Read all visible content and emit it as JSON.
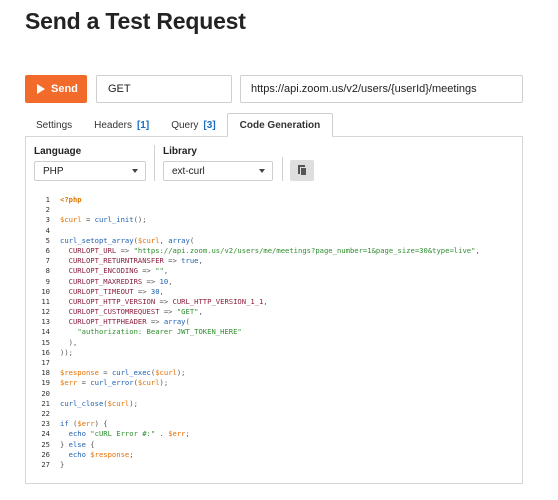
{
  "page": {
    "title": "Send a Test Request"
  },
  "request": {
    "send_label": "Send",
    "method": "GET",
    "url": "https://api.zoom.us/v2/users/{userId}/meetings"
  },
  "tabs": [
    {
      "label": "Settings",
      "count": ""
    },
    {
      "label": "Headers",
      "count": "[1]"
    },
    {
      "label": "Query",
      "count": "[3]"
    },
    {
      "label": "Code Generation",
      "count": "",
      "active": true
    }
  ],
  "codegen": {
    "language_label": "Language",
    "language_value": "PHP",
    "library_label": "Library",
    "library_value": "ext-curl",
    "copy_icon": "copy-icon"
  },
  "code_lines": [
    {
      "n": "1",
      "tokens": [
        [
          "kw",
          "<?php"
        ]
      ]
    },
    {
      "n": "2",
      "tokens": []
    },
    {
      "n": "3",
      "tokens": [
        [
          "var",
          "$curl"
        ],
        [
          "op",
          " = "
        ],
        [
          "fn",
          "curl_init"
        ],
        [
          "op",
          "();"
        ]
      ]
    },
    {
      "n": "4",
      "tokens": []
    },
    {
      "n": "5",
      "tokens": [
        [
          "fn",
          "curl_setopt_array"
        ],
        [
          "op",
          "("
        ],
        [
          "var",
          "$curl"
        ],
        [
          "op",
          ", "
        ],
        [
          "kw2",
          "array"
        ],
        [
          "op",
          "("
        ]
      ]
    },
    {
      "n": "6",
      "tokens": [
        [
          "op",
          "  "
        ],
        [
          "const",
          "CURLOPT_URL"
        ],
        [
          "op",
          " => "
        ],
        [
          "str",
          "\"https://api.zoom.us/v2/users/me/meetings?page_number=1&page_size=30&type=live\""
        ],
        [
          "op",
          ","
        ]
      ]
    },
    {
      "n": "7",
      "tokens": [
        [
          "op",
          "  "
        ],
        [
          "const",
          "CURLOPT_RETURNTRANSFER"
        ],
        [
          "op",
          " => "
        ],
        [
          "kw2",
          "true"
        ],
        [
          "op",
          ","
        ]
      ]
    },
    {
      "n": "8",
      "tokens": [
        [
          "op",
          "  "
        ],
        [
          "const",
          "CURLOPT_ENCODING"
        ],
        [
          "op",
          " => "
        ],
        [
          "str",
          "\"\""
        ],
        [
          "op",
          ","
        ]
      ]
    },
    {
      "n": "9",
      "tokens": [
        [
          "op",
          "  "
        ],
        [
          "const",
          "CURLOPT_MAXREDIRS"
        ],
        [
          "op",
          " => "
        ],
        [
          "num",
          "10"
        ],
        [
          "op",
          ","
        ]
      ]
    },
    {
      "n": "10",
      "tokens": [
        [
          "op",
          "  "
        ],
        [
          "const",
          "CURLOPT_TIMEOUT"
        ],
        [
          "op",
          " => "
        ],
        [
          "num",
          "30"
        ],
        [
          "op",
          ","
        ]
      ]
    },
    {
      "n": "11",
      "tokens": [
        [
          "op",
          "  "
        ],
        [
          "const",
          "CURLOPT_HTTP_VERSION"
        ],
        [
          "op",
          " => "
        ],
        [
          "const",
          "CURL_HTTP_VERSION_1_1"
        ],
        [
          "op",
          ","
        ]
      ]
    },
    {
      "n": "12",
      "tokens": [
        [
          "op",
          "  "
        ],
        [
          "const",
          "CURLOPT_CUSTOMREQUEST"
        ],
        [
          "op",
          " => "
        ],
        [
          "str",
          "\"GET\""
        ],
        [
          "op",
          ","
        ]
      ]
    },
    {
      "n": "13",
      "tokens": [
        [
          "op",
          "  "
        ],
        [
          "const",
          "CURLOPT_HTTPHEADER"
        ],
        [
          "op",
          " => "
        ],
        [
          "kw2",
          "array"
        ],
        [
          "op",
          "("
        ]
      ]
    },
    {
      "n": "14",
      "tokens": [
        [
          "op",
          "    "
        ],
        [
          "str",
          "\"authorization: Bearer JWT_TOKEN_HERE\""
        ]
      ]
    },
    {
      "n": "15",
      "tokens": [
        [
          "op",
          "  ),"
        ]
      ]
    },
    {
      "n": "16",
      "tokens": [
        [
          "op",
          "));"
        ]
      ]
    },
    {
      "n": "17",
      "tokens": []
    },
    {
      "n": "18",
      "tokens": [
        [
          "var",
          "$response"
        ],
        [
          "op",
          " = "
        ],
        [
          "fn",
          "curl_exec"
        ],
        [
          "op",
          "("
        ],
        [
          "var",
          "$curl"
        ],
        [
          "op",
          ");"
        ]
      ]
    },
    {
      "n": "19",
      "tokens": [
        [
          "var",
          "$err"
        ],
        [
          "op",
          " = "
        ],
        [
          "fn",
          "curl_error"
        ],
        [
          "op",
          "("
        ],
        [
          "var",
          "$curl"
        ],
        [
          "op",
          ");"
        ]
      ]
    },
    {
      "n": "20",
      "tokens": []
    },
    {
      "n": "21",
      "tokens": [
        [
          "fn",
          "curl_close"
        ],
        [
          "op",
          "("
        ],
        [
          "var",
          "$curl"
        ],
        [
          "op",
          ");"
        ]
      ]
    },
    {
      "n": "22",
      "tokens": []
    },
    {
      "n": "23",
      "tokens": [
        [
          "kw2",
          "if"
        ],
        [
          "op",
          " ("
        ],
        [
          "var",
          "$err"
        ],
        [
          "op",
          ") {"
        ]
      ]
    },
    {
      "n": "24",
      "tokens": [
        [
          "op",
          "  "
        ],
        [
          "kw2",
          "echo"
        ],
        [
          "op",
          " "
        ],
        [
          "str",
          "\"cURL Error #:\""
        ],
        [
          "op",
          " . "
        ],
        [
          "var",
          "$err"
        ],
        [
          "op",
          ";"
        ]
      ]
    },
    {
      "n": "25",
      "tokens": [
        [
          "op",
          "} "
        ],
        [
          "kw2",
          "else"
        ],
        [
          "op",
          " {"
        ]
      ]
    },
    {
      "n": "26",
      "tokens": [
        [
          "op",
          "  "
        ],
        [
          "kw2",
          "echo"
        ],
        [
          "op",
          " "
        ],
        [
          "var",
          "$response"
        ],
        [
          "op",
          ";"
        ]
      ]
    },
    {
      "n": "27",
      "tokens": [
        [
          "op",
          "}"
        ]
      ]
    }
  ]
}
